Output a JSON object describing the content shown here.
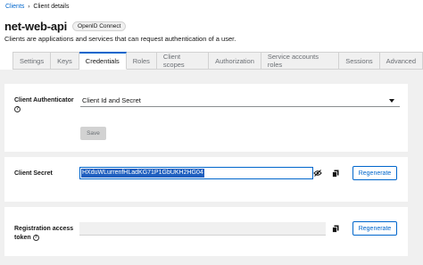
{
  "breadcrumb": {
    "link": "Clients",
    "separator": "›",
    "current": "Client details"
  },
  "header": {
    "title": "net-web-api",
    "badge": "OpenID Connect",
    "subtitle": "Clients are applications and services that can request authentication of a user."
  },
  "tabs": [
    {
      "label": "Settings"
    },
    {
      "label": "Keys"
    },
    {
      "label": "Credentials"
    },
    {
      "label": "Roles"
    },
    {
      "label": "Client scopes"
    },
    {
      "label": "Authorization"
    },
    {
      "label": "Service accounts roles"
    },
    {
      "label": "Sessions"
    },
    {
      "label": "Advanced"
    }
  ],
  "active_tab": "Credentials",
  "authenticator": {
    "label": "Client Authenticator",
    "help": "?",
    "value": "Client Id and Secret",
    "save_label": "Save"
  },
  "secret": {
    "label": "Client Secret",
    "value": "HXduWLurrenfHLadKG71P1GbUKH2HG04",
    "regenerate_label": "Regenerate",
    "hide_icon": "eye-slash-icon",
    "copy_icon": "copy-icon"
  },
  "registration": {
    "label_line1": "Registration access",
    "label_line2": "token",
    "help": "?",
    "value": "",
    "regenerate_label": "Regenerate",
    "copy_icon": "copy-icon"
  },
  "colors": {
    "accent": "#0066cc",
    "selection": "#1f5fbf",
    "background": "#f0f0f0"
  }
}
